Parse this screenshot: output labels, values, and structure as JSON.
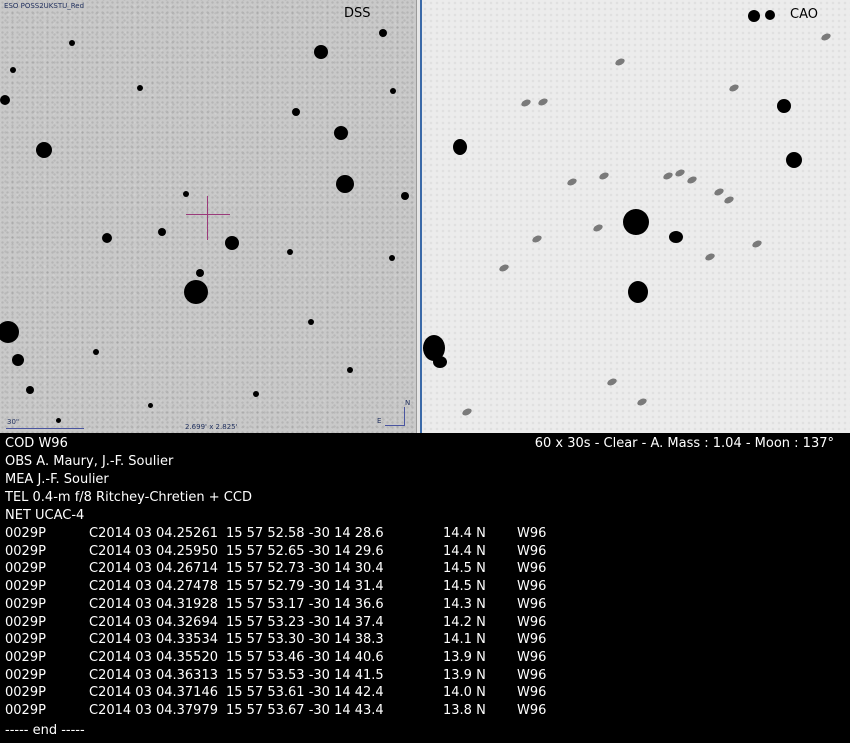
{
  "images": {
    "left": {
      "label": "DSS",
      "survey": "ESO POSS2UKSTU_Red",
      "scale": "30\"",
      "fov": "2.699' x 2.825'",
      "compass_n": "N",
      "compass_e": "E"
    },
    "right": {
      "label": "CAO"
    }
  },
  "report": {
    "header": [
      "COD W96",
      "OBS A. Maury, J.-F. Soulier",
      "MEA J.-F. Soulier",
      "TEL 0.4-m f/8 Ritchey-Chretien + CCD",
      "NET UCAC-4"
    ],
    "conditions": "60 x 30s - Clear - A. Mass : 1.04 - Moon : 137°",
    "observations": [
      {
        "object": "0029P",
        "date": "C2014 03 04.25261",
        "coords": "15 57 52.58 -30 14 28.6",
        "mag": "14.4 N",
        "code": "W96"
      },
      {
        "object": "0029P",
        "date": "C2014 03 04.25950",
        "coords": "15 57 52.65 -30 14 29.6",
        "mag": "14.4 N",
        "code": "W96"
      },
      {
        "object": "0029P",
        "date": "C2014 03 04.26714",
        "coords": "15 57 52.73 -30 14 30.4",
        "mag": "14.5 N",
        "code": "W96"
      },
      {
        "object": "0029P",
        "date": "C2014 03 04.27478",
        "coords": "15 57 52.79 -30 14 31.4",
        "mag": "14.5 N",
        "code": "W96"
      },
      {
        "object": "0029P",
        "date": "C2014 03 04.31928",
        "coords": "15 57 53.17 -30 14 36.6",
        "mag": "14.3 N",
        "code": "W96"
      },
      {
        "object": "0029P",
        "date": "C2014 03 04.32694",
        "coords": "15 57 53.23 -30 14 37.4",
        "mag": "14.2 N",
        "code": "W96"
      },
      {
        "object": "0029P",
        "date": "C2014 03 04.33534",
        "coords": "15 57 53.30 -30 14 38.3",
        "mag": "14.1 N",
        "code": "W96"
      },
      {
        "object": "0029P",
        "date": "C2014 03 04.35520",
        "coords": "15 57 53.46 -30 14 40.6",
        "mag": "13.9 N",
        "code": "W96"
      },
      {
        "object": "0029P",
        "date": "C2014 03 04.36313",
        "coords": "15 57 53.53 -30 14 41.5",
        "mag": "13.9 N",
        "code": "W96"
      },
      {
        "object": "0029P",
        "date": "C2014 03 04.37146",
        "coords": "15 57 53.61 -30 14 42.4",
        "mag": "14.0 N",
        "code": "W96"
      },
      {
        "object": "0029P",
        "date": "C2014 03 04.37979",
        "coords": "15 57 53.67 -30 14 43.4",
        "mag": "13.8 N",
        "code": "W96"
      }
    ],
    "footer": "----- end -----"
  }
}
